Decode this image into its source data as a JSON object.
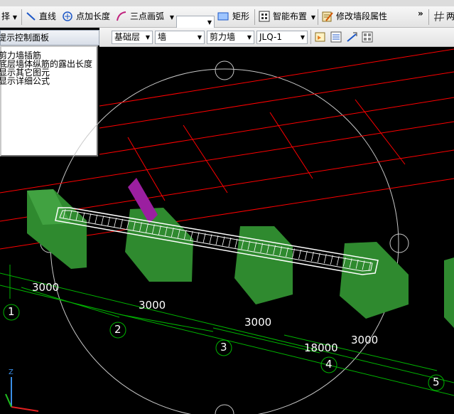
{
  "toolbar1": {
    "select_label": "择",
    "line_label": "直线",
    "point_length_label": "点加长度",
    "three_point_arc_label": "三点画弧",
    "rect_label": "矩形",
    "smart_layout_label": "智能布置",
    "modify_wall_props_label": "修改墙段属性",
    "overflow_label": "»",
    "extra_label": "两"
  },
  "toolbar2": {
    "floor_value": "基础层",
    "type_value": "墙",
    "subtype_value": "剪力墙",
    "component_value": "JLQ-1"
  },
  "panel": {
    "title": "提示控制面板",
    "items": [
      "剪力墙插筋",
      "底层墙体纵筋的露出长度",
      "显示其它图元",
      "显示详细公式"
    ]
  },
  "canvas": {
    "dimensions": [
      "3000",
      "3000",
      "3000",
      "18000",
      "3000"
    ],
    "axes": [
      "1",
      "2",
      "3",
      "4",
      "5"
    ],
    "colors": {
      "grid_red": "#ff0000",
      "grid_green": "#00b400",
      "block_green": "#2f8a2f",
      "column_purple": "#9b1fa0",
      "background": "#000000"
    }
  }
}
